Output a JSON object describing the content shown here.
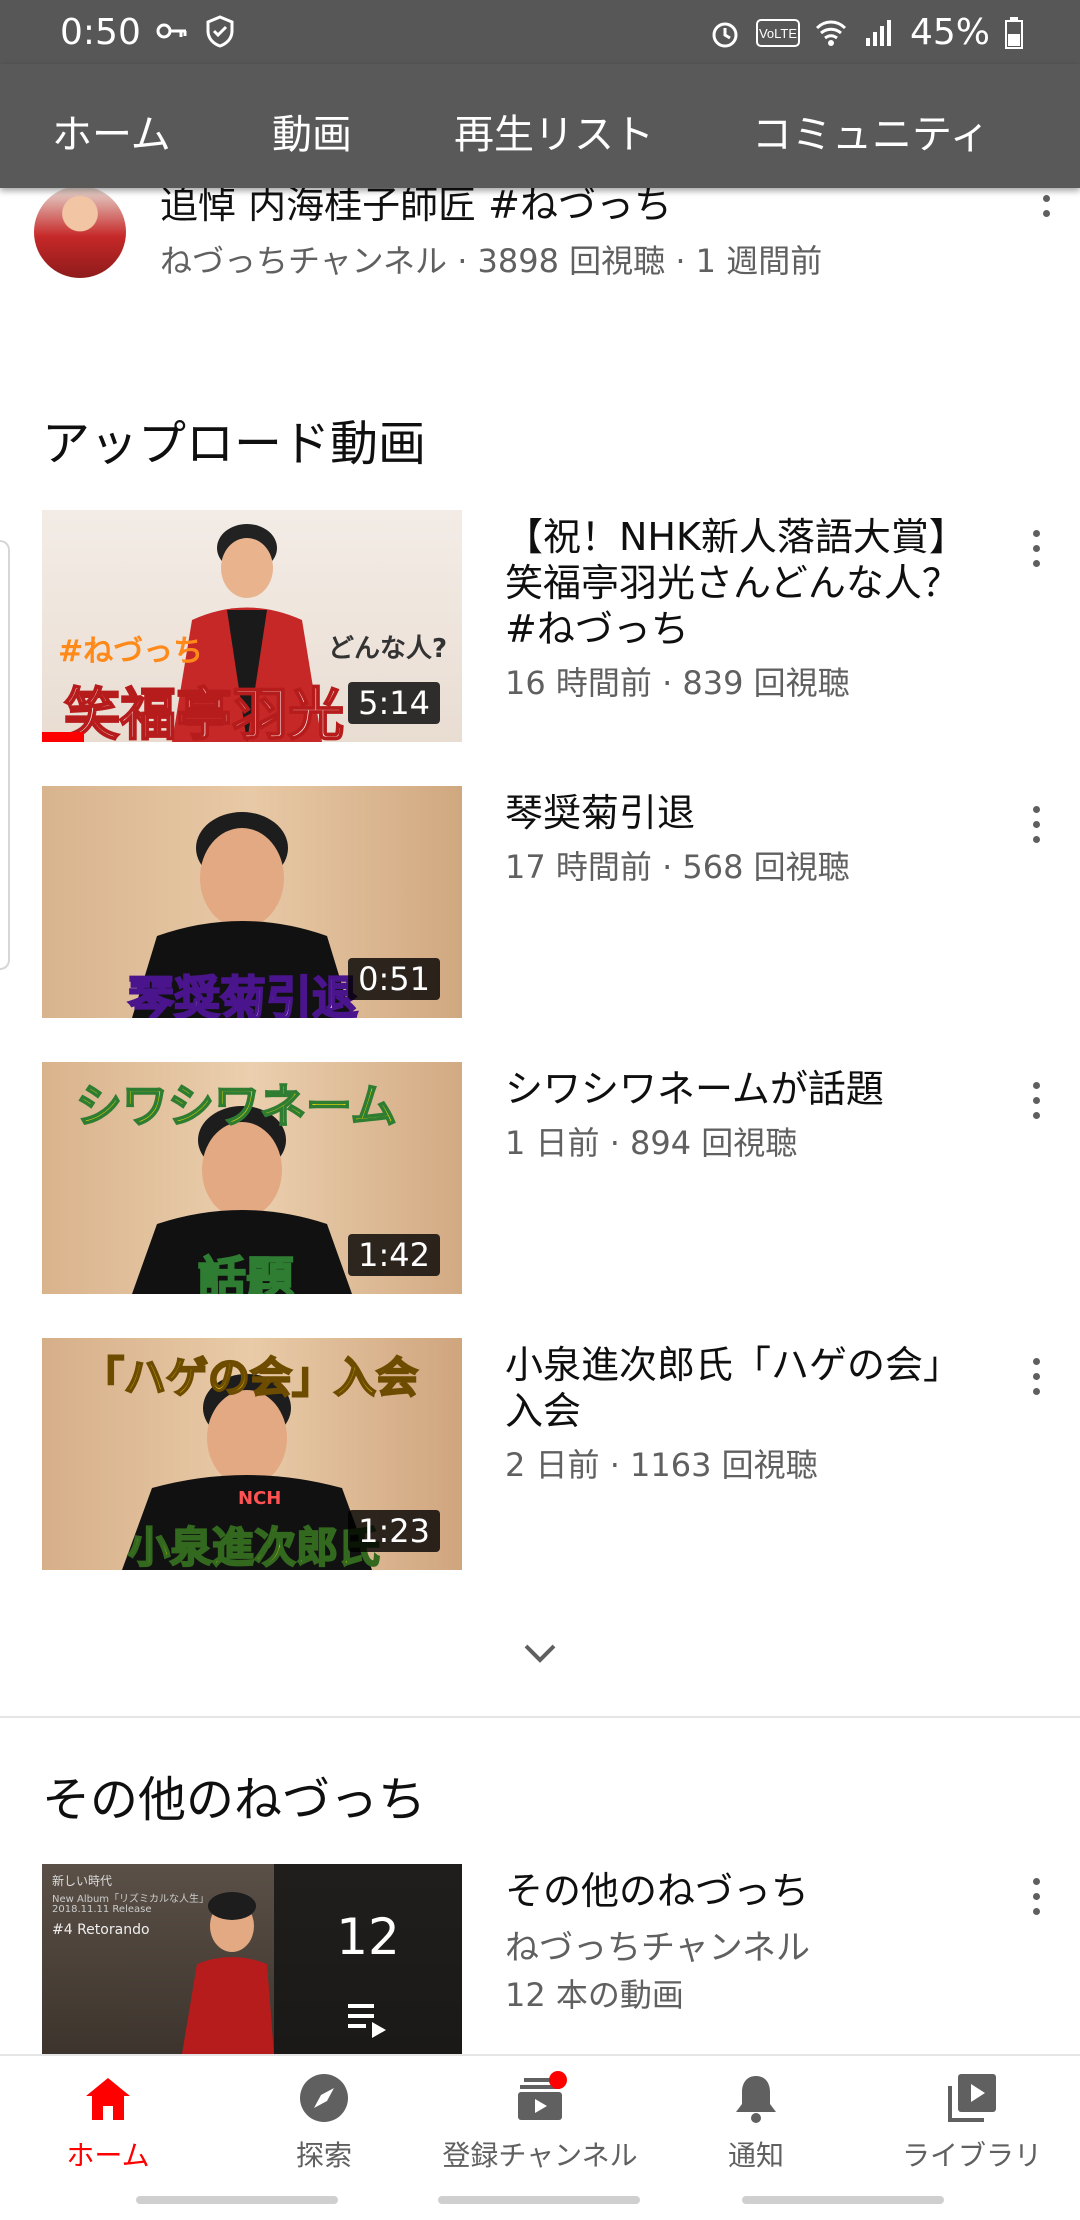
{
  "status_bar": {
    "time": "0:50",
    "battery": "45%",
    "icons": [
      "key-icon",
      "shield-check-icon",
      "alarm-icon",
      "volte-icon",
      "wifi-icon",
      "signal-icon",
      "battery-icon"
    ],
    "volte": "VoLTE"
  },
  "tabs": [
    "ホーム",
    "動画",
    "再生リスト",
    "コミュニティ"
  ],
  "partial_row": {
    "title": "追悼 内海桂子師匠 #ねづっち",
    "meta": "ねづっちチャンネル · 3898 回視聴 · 1 週間前"
  },
  "uploads": {
    "section_title": "アップロード動画",
    "videos": [
      {
        "title": "【祝！NHK新人落語大賞】笑福亭羽光さんどんな人？#ねづっち",
        "meta": "16 時間前 · 839 回視聴",
        "duration": "5:14",
        "caption_main": "笑福亭羽光",
        "caption_tag": "#ねづっち",
        "caption_sub": "どんな人?",
        "watched_fraction": 0.1
      },
      {
        "title": "琴奨菊引退",
        "meta": "17 時間前 · 568 回視聴",
        "duration": "0:51",
        "caption_main": "琴奨菊引退"
      },
      {
        "title": "シワシワネームが話題",
        "meta": "1 日前 · 894 回視聴",
        "duration": "1:42",
        "caption_top": "シワシワネーム",
        "caption_main": "話題"
      },
      {
        "title": "小泉進次郎氏「ハゲの会」入会",
        "meta": "2 日前 · 1163 回視聴",
        "duration": "1:23",
        "caption_top": "「ハゲの会」入会",
        "caption_main": "小泉進次郎氏",
        "shirt_text": "NCH"
      }
    ]
  },
  "other": {
    "section_title": "その他のねづっち",
    "playlist": {
      "title": "その他のねづっち",
      "channel": "ねづっちチャンネル",
      "count_label": "12 本の動画",
      "overlay_count": "12",
      "thumb_lines": [
        "新しい時代",
        "New Album「リズミカルな人生」",
        "2018.11.11 Release",
        "#4 Retorando"
      ]
    }
  },
  "bottom_nav": [
    {
      "label": "ホーム",
      "icon": "home-icon",
      "active": true
    },
    {
      "label": "探索",
      "icon": "compass-icon",
      "active": false
    },
    {
      "label": "登録チャンネル",
      "icon": "subscriptions-icon",
      "active": false,
      "badge": true
    },
    {
      "label": "通知",
      "icon": "bell-icon",
      "active": false
    },
    {
      "label": "ライブラリ",
      "icon": "library-icon",
      "active": false
    }
  ],
  "colors": {
    "accent": "#ff0000",
    "topbar": "#595959",
    "status_bar": "#575757",
    "meta_text": "#606060"
  }
}
